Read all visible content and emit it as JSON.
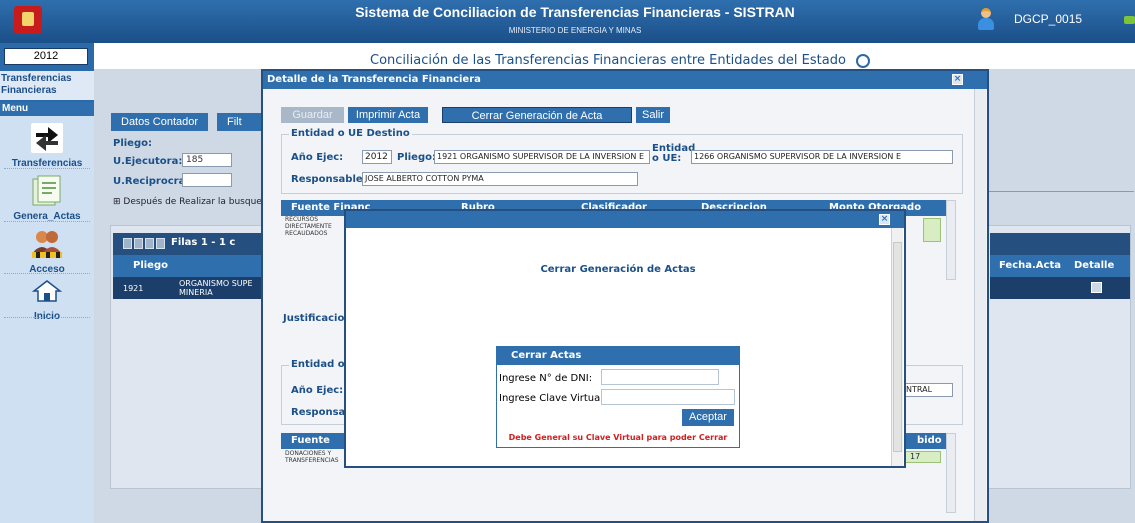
{
  "header": {
    "title": "Sistema de Conciliacion de Transferencias Financieras - SISTRAN",
    "subtitle": "MINISTERIO DE ENERGIA Y MINAS",
    "username": "DGCP_0015"
  },
  "sidebar": {
    "year": "2012",
    "section_title": "Transferencias Financieras",
    "menu_label": "Menu",
    "items": [
      {
        "label": "Transferencias",
        "icon": "transfer-icon"
      },
      {
        "label": "Genera_Actas",
        "icon": "document-icon"
      },
      {
        "label": "Acceso",
        "icon": "users-icon"
      },
      {
        "label": "Inicio",
        "icon": "home-icon"
      }
    ]
  },
  "page": {
    "title": "Conciliación de las Transferencias Financieras entre Entidades del Estado",
    "tabs": [
      "Datos Contador",
      "Filt"
    ],
    "pliego_label": "Pliego:",
    "ejecutora_label": "U.Ejecutora:",
    "ejecutora_value": "185",
    "reciprocra_label": "U.Reciprocra:",
    "note": "Después de Realizar la busque",
    "grid": {
      "filas": "Filas 1 - 1 c",
      "pliego_header": "Pliego",
      "row_pliego": "1921",
      "row_name": "ORGANISMO SUPE MINERIA",
      "fecha_header": "Fecha.Acta",
      "detalle_header": "Detalle"
    }
  },
  "detalle_modal": {
    "title": "Detalle de la Transferencia Financiera",
    "buttons": {
      "guardar": "Guardar",
      "imprimir": "Imprimir Acta",
      "cerrar": "Cerrar Generación de Acta",
      "salir": "Salir"
    },
    "destino": {
      "legend": "Entidad o UE Destino",
      "anio_label": "Año Ejec:",
      "anio_value": "2012",
      "pliego_label": "Pliego:",
      "pliego_value": "1921 ORGANISMO SUPERVISOR DE LA INVERSION E",
      "entidad_label": "Entidad o UE:",
      "entidad_value": "1266 ORGANISMO SUPERVISOR DE LA INVERSION E",
      "responsable_label": "Responsable:",
      "responsable_value": "JOSE ALBERTO COTTON PYMA"
    },
    "table1": {
      "headers": [
        "Fuente Financ",
        "Rubro",
        "Clasificador",
        "Descripcion",
        "Monto Otorgado"
      ],
      "row_fuente": "RECURSOS DIRECTAMENTE RECAUDADOS"
    },
    "justificacion_label": "Justificacion",
    "origen": {
      "legend": "Entidad o U",
      "anio_label": "Año Ejec:",
      "responsable_label": "Responsab",
      "entidad_partial": "NTRAL"
    },
    "table2": {
      "header_fuente": "Fuente",
      "header_recibido": "bido",
      "row_fuente": "DONACIONES Y TRANSFERENCIAS",
      "row_value": "17"
    }
  },
  "cerrar_modal": {
    "heading": "Cerrar Generación de Actas",
    "box": {
      "title": "Cerrar Actas",
      "dni_label": "Ingrese N° de DNI:",
      "dni_value": "",
      "clave_label": "Ingrese Clave Virtual:",
      "clave_value": "",
      "submit": "Aceptar",
      "message": "Debe General su Clave Virtual para poder Cerrar"
    }
  },
  "colors": {
    "header_blue": "#1b4f88",
    "button_blue": "#2f6fae",
    "error_red": "#d02020"
  }
}
